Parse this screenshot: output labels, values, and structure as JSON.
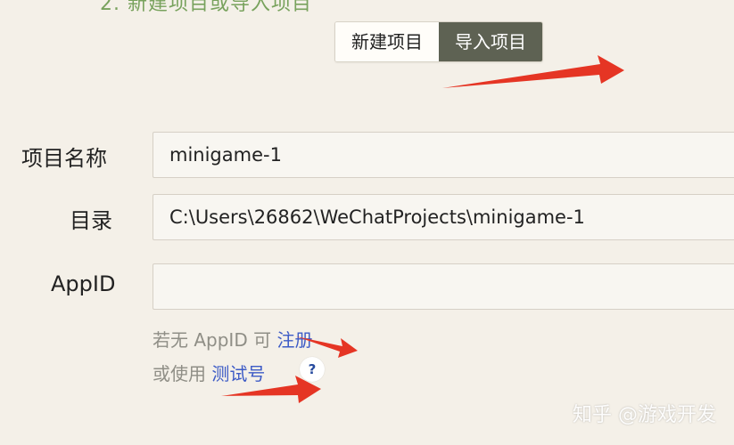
{
  "top_partial_text": "2. 新建项目或导入项目",
  "tabs": [
    {
      "label": "新建项目",
      "active": false
    },
    {
      "label": "导入项目",
      "active": true
    }
  ],
  "form": {
    "project_name": {
      "label": "项目名称",
      "value": "minigame-1"
    },
    "directory": {
      "label": "目录",
      "value": "C:\\Users\\26862\\WeChatProjects\\minigame-1"
    },
    "appid": {
      "label": "AppID",
      "value": ""
    }
  },
  "hints": {
    "line1_prefix": "若无 AppID 可 ",
    "register_link": "注册",
    "line2_prefix": "或使用 ",
    "test_account_link": "测试号",
    "help_icon": "?"
  },
  "watermark": "知乎 @游戏开发",
  "colors": {
    "background": "#f4f0e8",
    "active_tab": "#5e6253",
    "link": "#3d5bc6",
    "arrow": "#e53524"
  }
}
